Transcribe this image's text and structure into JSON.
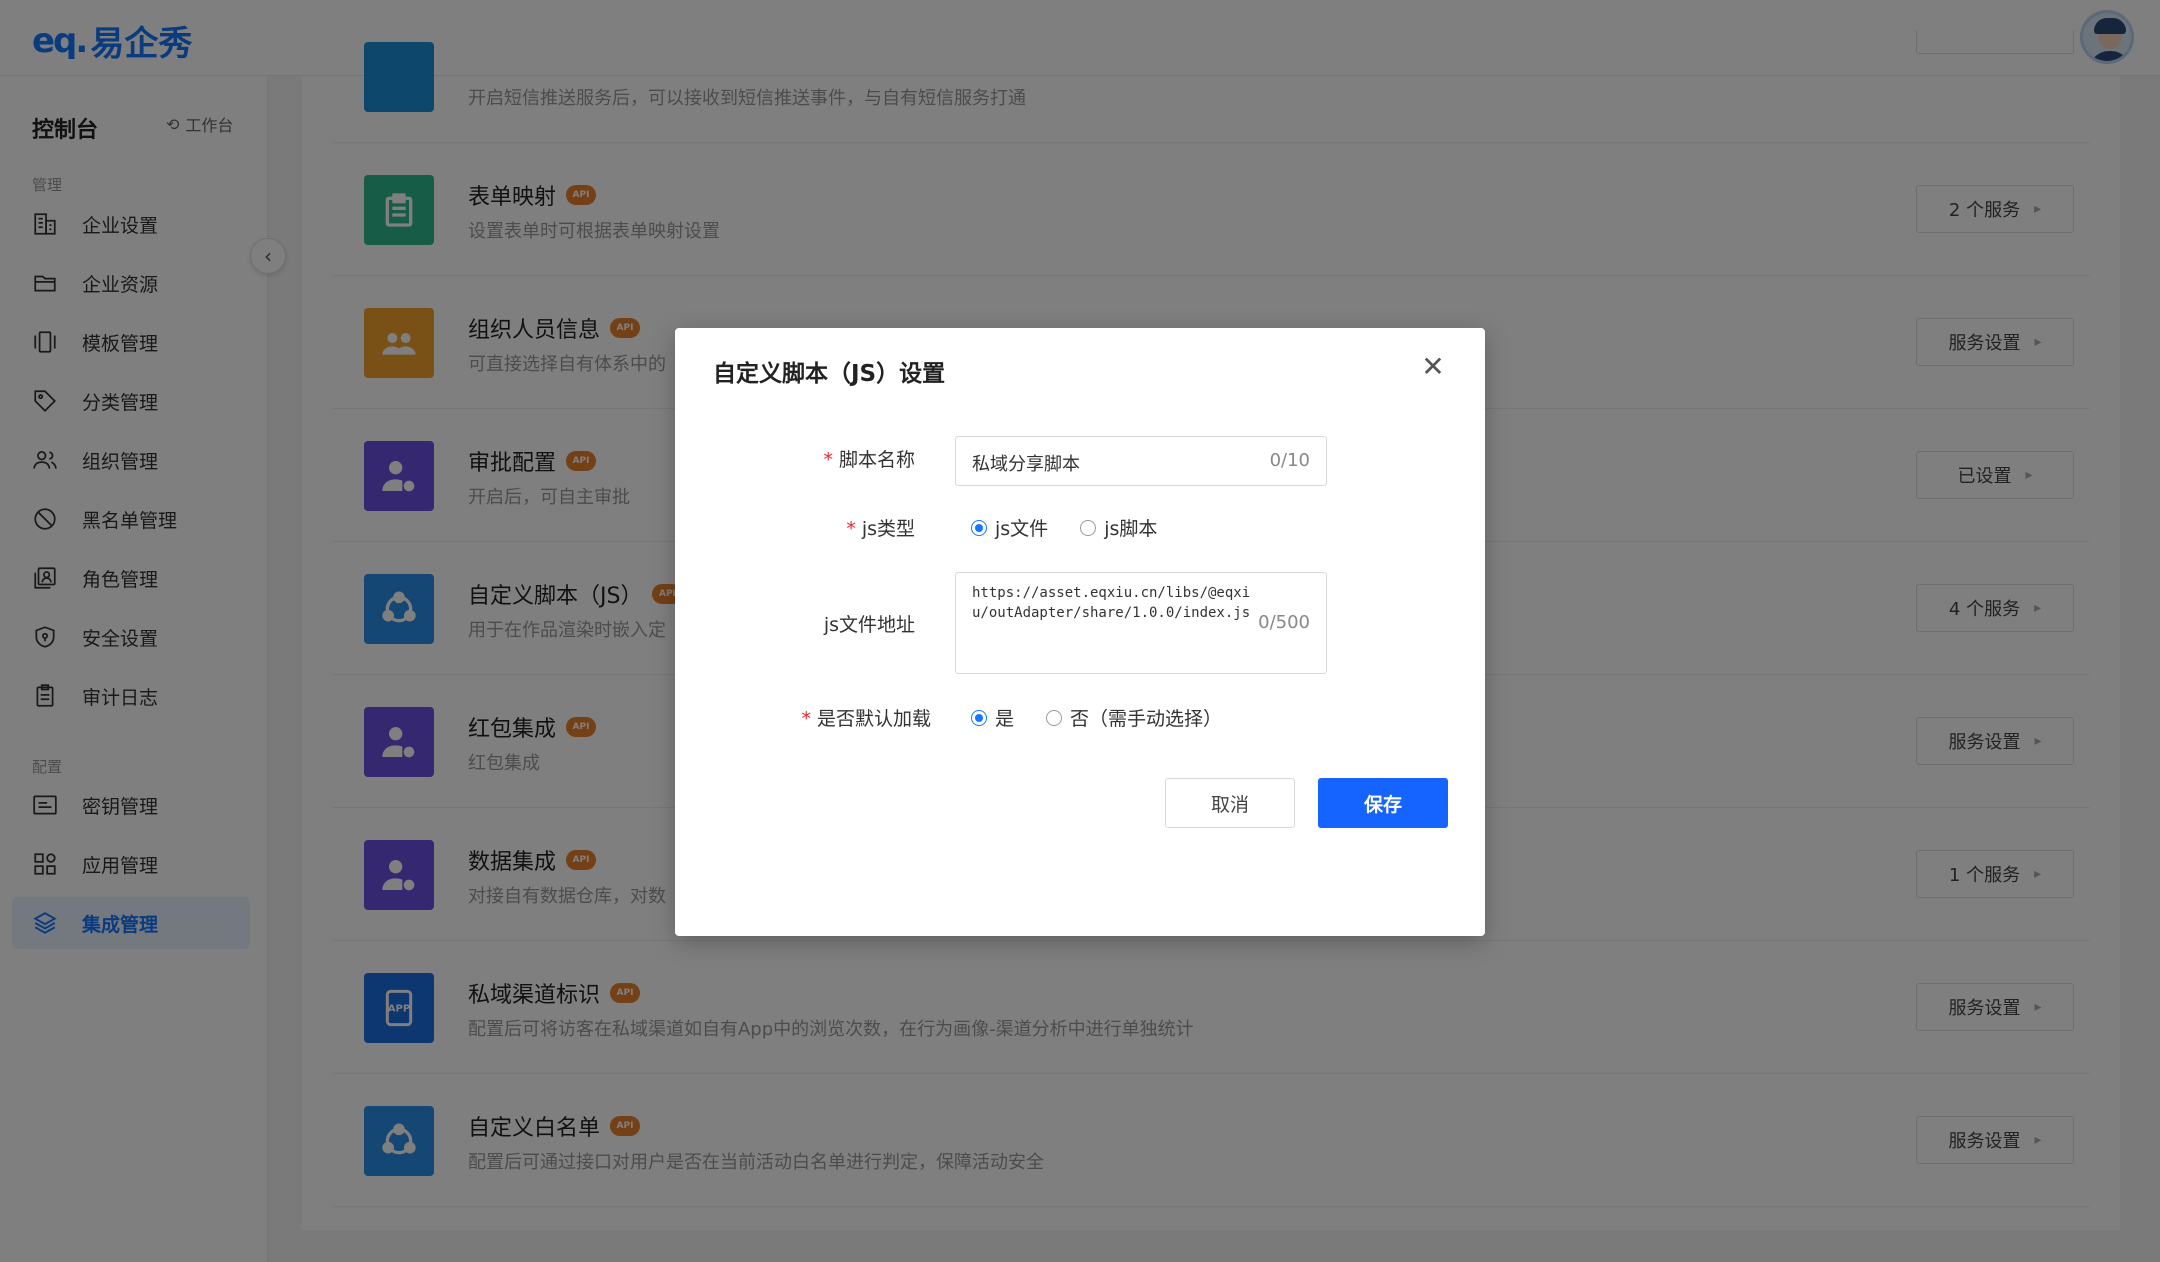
{
  "header": {
    "logo_mark": "eq.",
    "logo_text": "易企秀"
  },
  "sidebar": {
    "title": "控制台",
    "workbench_label": "工作台",
    "section_manage": "管理",
    "section_config": "配置",
    "items": [
      {
        "label": "企业设置",
        "icon": "building-icon"
      },
      {
        "label": "企业资源",
        "icon": "folder-icon"
      },
      {
        "label": "模板管理",
        "icon": "template-icon"
      },
      {
        "label": "分类管理",
        "icon": "tag-icon"
      },
      {
        "label": "组织管理",
        "icon": "users-icon"
      },
      {
        "label": "黑名单管理",
        "icon": "ban-icon"
      },
      {
        "label": "角色管理",
        "icon": "role-icon"
      },
      {
        "label": "安全设置",
        "icon": "shield-icon"
      },
      {
        "label": "审计日志",
        "icon": "clipboard-icon"
      },
      {
        "label": "密钥管理",
        "icon": "key-card-icon"
      },
      {
        "label": "应用管理",
        "icon": "apps-icon"
      },
      {
        "label": "集成管理",
        "icon": "layers-icon",
        "active": true
      }
    ]
  },
  "integrations": {
    "api_badge": "API",
    "rows": [
      {
        "title": "",
        "desc": "开启短信推送服务后，可以接收到短信推送事件，与自有短信服务打通",
        "button": "",
        "icon_color": "#1a8fd8"
      },
      {
        "title": "表单映射",
        "desc": "设置表单时可根据表单映射设置",
        "button": "2 个服务",
        "icon_color": "#2db88e"
      },
      {
        "title": "组织人员信息",
        "desc": "可直接选择自有体系中的",
        "button": "服务设置",
        "icon_color": "#f2a22c"
      },
      {
        "title": "审批配置",
        "desc": "开启后，可自主审批",
        "button": "已设置",
        "icon_color": "#6b4fe0"
      },
      {
        "title": "自定义脚本（JS）",
        "desc": "用于在作品渲染时嵌入定",
        "button": "4 个服务",
        "icon_color": "#2a8fe8"
      },
      {
        "title": "红包集成",
        "desc": "红包集成",
        "button": "服务设置",
        "icon_color": "#6b4fe0"
      },
      {
        "title": "数据集成",
        "desc": "对接自有数据仓库，对数",
        "button": "1 个服务",
        "icon_color": "#6b4fe0"
      },
      {
        "title": "私域渠道标识",
        "desc": "配置后可将访客在私域渠道如自有App中的浏览次数，在行为画像-渠道分析中进行单独统计",
        "button": "服务设置",
        "icon_color": "#1a6ee0"
      },
      {
        "title": "自定义白名单",
        "desc": "配置后可通过接口对用户是否在当前活动白名单进行判定，保障活动安全",
        "button": "服务设置",
        "icon_color": "#2a8fe8"
      }
    ]
  },
  "modal": {
    "title": "自定义脚本（JS）设置",
    "script_name_label": "脚本名称",
    "script_name_value": "私域分享脚本",
    "script_name_count": "0/10",
    "js_type_label": "js类型",
    "js_type_options": [
      "js文件",
      "js脚本"
    ],
    "js_type_selected": "js文件",
    "js_url_label": "js文件地址",
    "js_url_value": "https://asset.eqxiu.cn/libs/@eqxiu/outAdapter/share/1.0.0/index.js",
    "js_url_count": "0/500",
    "default_load_label": "是否默认加载",
    "default_load_options": [
      "是",
      "否（需手动选择）"
    ],
    "default_load_selected": "是",
    "cancel_label": "取消",
    "save_label": "保存"
  }
}
